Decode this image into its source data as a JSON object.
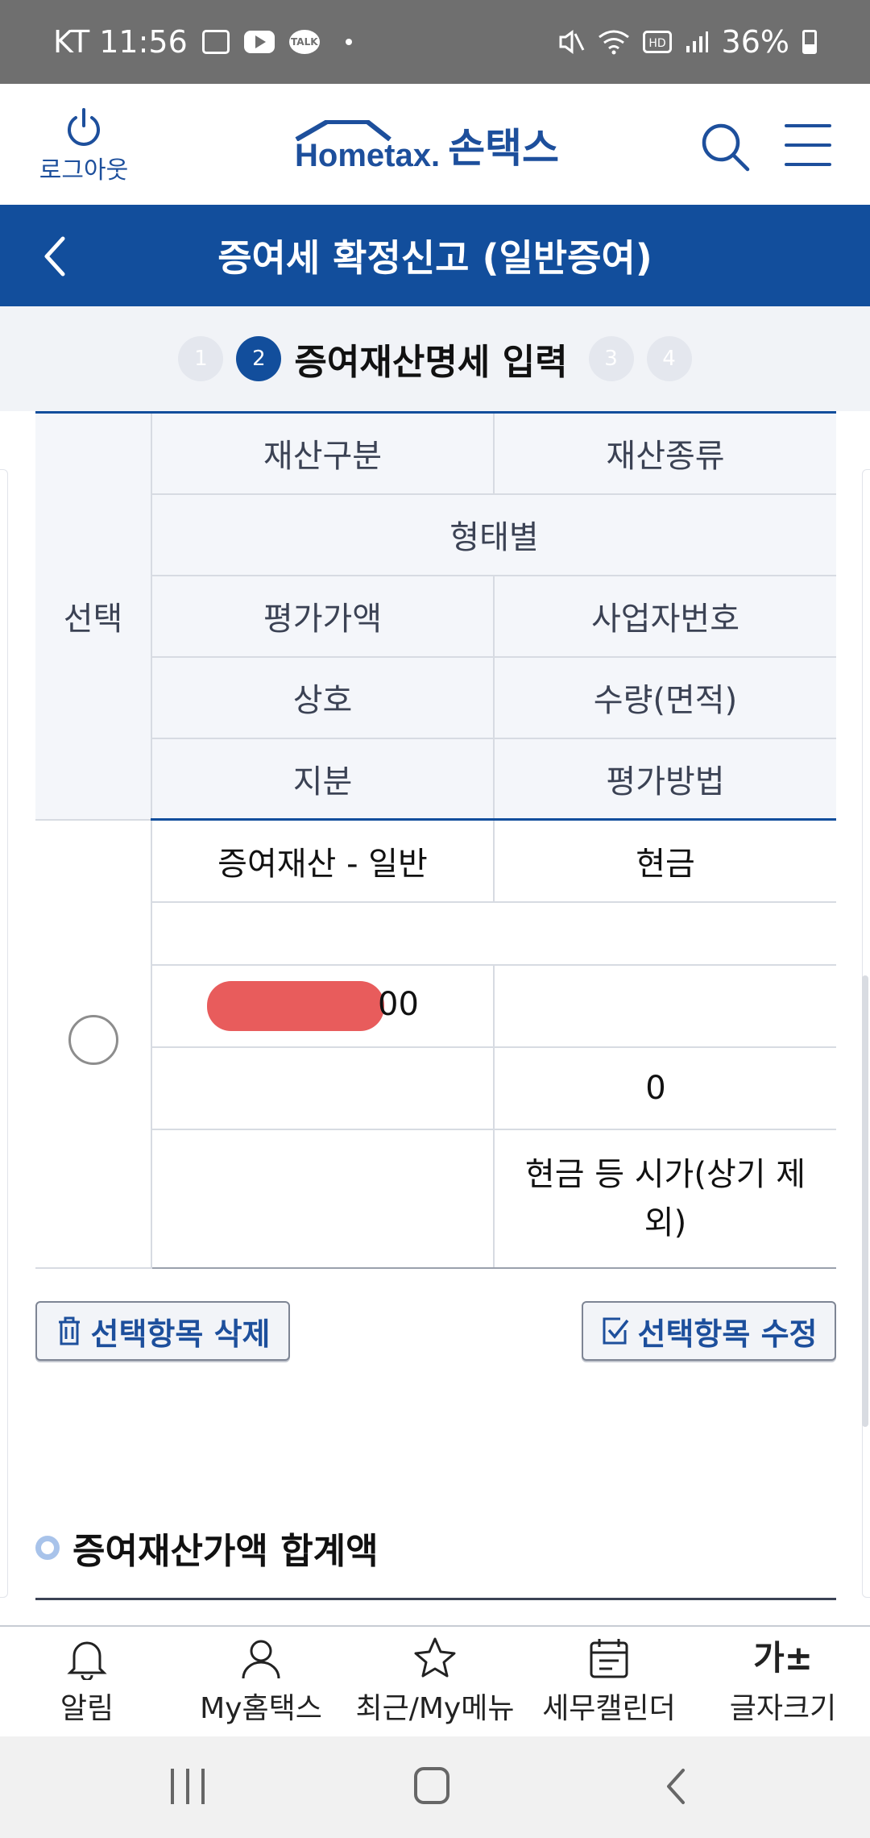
{
  "status_bar": {
    "carrier_time": "KT 11:56",
    "battery": "36%"
  },
  "header": {
    "logout_label": "로그아웃",
    "logo_en": "Hometax.",
    "logo_ko": "손택스",
    "brand_color": "#124e9c"
  },
  "title_bar": {
    "title": "증여세 확정신고 (일반증여)"
  },
  "steps": {
    "items": [
      "1",
      "2",
      "3",
      "4"
    ],
    "active_label": "증여재산명세 입력"
  },
  "table": {
    "select_header": "선택",
    "headers": {
      "r1c1": "재산구분",
      "r1c2": "재산종류",
      "r2": "형태별",
      "r3c1": "평가가액",
      "r3c2": "사업자번호",
      "r4c1": "상호",
      "r4c2": "수량(면적)",
      "r5c1": "지분",
      "r5c2": "평가방법"
    },
    "row": {
      "category": "증여재산 - 일반",
      "type": "현금",
      "form": "",
      "value_suffix": "00",
      "business_no": "",
      "company": "",
      "quantity": "0",
      "share": "",
      "method": "현금 등 시가(상기 제외)"
    }
  },
  "buttons": {
    "delete_label": "선택항목 삭제",
    "edit_label": "선택항목 수정"
  },
  "section": {
    "title": "증여재산가액 합계액"
  },
  "bottom_nav": {
    "items": [
      "알림",
      "My홈택스",
      "최근/My메뉴",
      "세무캘린더",
      "글자크기"
    ],
    "font_icon_text": "가±"
  }
}
